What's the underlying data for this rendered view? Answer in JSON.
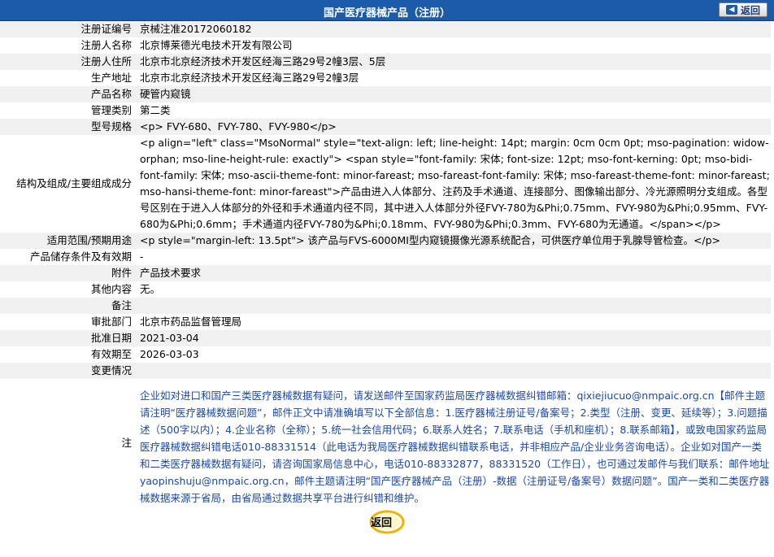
{
  "header": {
    "title": "国产医疗器械产品（注册）",
    "back_label": "返回"
  },
  "rows": [
    {
      "label": "注册证编号",
      "value": "京械注准20172060182"
    },
    {
      "label": "注册人名称",
      "value": "北京博莱德光电技术开发有限公司"
    },
    {
      "label": "注册人住所",
      "value": "北京市北京经济技术开发区经海三路29号2幢3层、5层"
    },
    {
      "label": "生产地址",
      "value": "北京市北京经济技术开发区经海三路29号2幢3层"
    },
    {
      "label": "产品名称",
      "value": "硬管内窥镜"
    },
    {
      "label": "管理类别",
      "value": "第二类"
    },
    {
      "label": "型号规格",
      "value": "<p> FVY-680、FVY-780、FVY-980</p>"
    },
    {
      "label": "结构及组成/主要组成成分",
      "value": "<p align=\"left\" class=\"MsoNormal\" style=\"text-align: left; line-height: 14pt; margin: 0cm 0cm 0pt; mso-pagination: widow-orphan; mso-line-height-rule: exactly\"> <span style=\"font-family: 宋体; font-size: 12pt; mso-font-kerning: 0pt; mso-bidi-font-family: 宋体; mso-ascii-theme-font: minor-fareast; mso-fareast-font-family: 宋体; mso-fareast-theme-font: minor-fareast; mso-hansi-theme-font: minor-fareast\">产品由进入人体部分、注药及手术通道、连接部分、图像输出部分、冷光源照明分支组成。各型号区别在于进入人体部分的外径和手术通道内径不同，其中进入人体部分外径FVY-780为&Phi;0.75mm、FVY-980为&Phi;0.95mm、FVY-680为&Phi;0.6mm；手术通道内径FVY-780为&Phi;0.18mm、FVY-980为&Phi;0.3mm、FVY-680为无通道。</span></p>"
    },
    {
      "label": "适用范围/预期用途",
      "value": "<p style=\"margin-left: 13.5pt\"> 该产品与FVS-6000MI型内窥镜摄像光源系统配合，可供医疗单位用于乳腺导管检查。</p>"
    },
    {
      "label": "产品储存条件及有效期",
      "value": "-"
    },
    {
      "label": "附件",
      "value": "产品技术要求"
    },
    {
      "label": "其他内容",
      "value": "无。"
    },
    {
      "label": "备注",
      "value": ""
    },
    {
      "label": "审批部门",
      "value": "北京市药品监督管理局"
    },
    {
      "label": "批准日期",
      "value": "2021-03-04"
    },
    {
      "label": "有效期至",
      "value": "2026-03-03"
    },
    {
      "label": "变更情况",
      "value": ""
    }
  ],
  "note": {
    "label": "注",
    "text": "企业如对进口和国产三类医疗器械数据有疑问，请发送邮件至国家药监局医疗器械数据纠错邮箱：qixiejiucuo@nmpaic.org.cn【邮件主题请注明“医疗器械数据问题”，邮件正文中请准确填写以下全部信息：1.医疗器械注册证号/备案号；2.类型（注册、变更、延续等）；3.问题描述（500字以内）；4.企业名称（全称）；5.统一社会信用代码；6.联系人姓名；7.联系电话（手机和座机）；8.联系邮箱】，或致电国家药监局医疗器械数据纠错电话010-88331514（此电话为我局医疗器械数据纠错联系电话，并非相应产品/企业业务咨询电话）。企业如对国产一类和二类医疗器械数据有疑问，请咨询国家局信息中心，电话010-88332877，88331520（工作日），也可通过发邮件与我们联系：邮件地址yaopinshuju@nmpaic.org.cn，邮件主题请注明“国产医疗器械产品（注册）-数据（注册证号/备案号）数据问题”。国产一类和二类医疗器械数据来源于省局，由省局通过数据共享平台进行纠错和维护。"
  },
  "footer": {
    "back_label": "返回"
  },
  "colors": {
    "header_bg": "#1b5ba8",
    "row_alt_bg": "#f0f0f0",
    "note_text": "#1b4aa0"
  }
}
